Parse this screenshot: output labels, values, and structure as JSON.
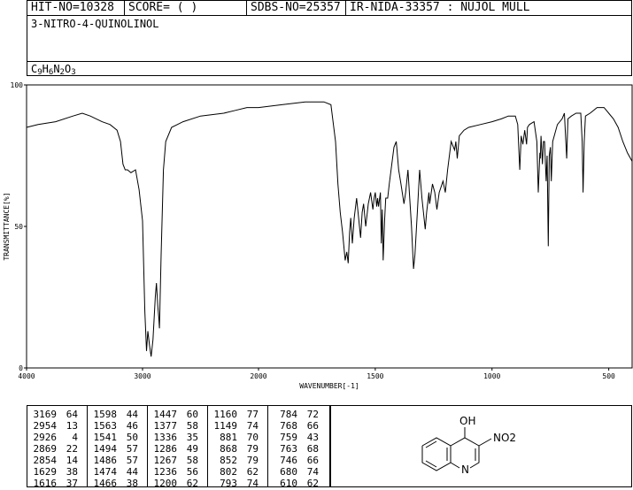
{
  "header": {
    "hit_no": "HIT-NO=10328",
    "score": "SCORE=  (   )",
    "sdbs_no": "SDBS-NO=25357",
    "ir_info": "IR-NIDA-33357 : NUJOL MULL",
    "compound_name": "3-NITRO-4-QUINOLINOL",
    "formula_parts": [
      {
        "t": "C",
        "sub": false
      },
      {
        "t": "9",
        "sub": true
      },
      {
        "t": "H",
        "sub": false
      },
      {
        "t": "6",
        "sub": true
      },
      {
        "t": "N",
        "sub": false
      },
      {
        "t": "2",
        "sub": true
      },
      {
        "t": "O",
        "sub": false
      },
      {
        "t": "3",
        "sub": true
      }
    ]
  },
  "chart_data": {
    "type": "line",
    "xlabel": "WAVENUMBER[-1]",
    "ylabel": "TRANSMITTANCE[%]",
    "xlim": [
      4000,
      400
    ],
    "ylim": [
      0,
      100
    ],
    "x_ticks": [
      4000,
      3000,
      2000,
      1500,
      1000,
      500
    ],
    "y_ticks": [
      0,
      50,
      100
    ],
    "series": [
      {
        "points": [
          [
            4000,
            85
          ],
          [
            3900,
            86
          ],
          [
            3750,
            87
          ],
          [
            3600,
            89
          ],
          [
            3520,
            90
          ],
          [
            3450,
            89
          ],
          [
            3350,
            87
          ],
          [
            3280,
            86
          ],
          [
            3220,
            84
          ],
          [
            3190,
            80
          ],
          [
            3169,
            72
          ],
          [
            3150,
            70
          ],
          [
            3130,
            70
          ],
          [
            3100,
            69
          ],
          [
            3060,
            70
          ],
          [
            3030,
            63
          ],
          [
            3000,
            52
          ],
          [
            2980,
            20
          ],
          [
            2966,
            6
          ],
          [
            2954,
            13
          ],
          [
            2940,
            8
          ],
          [
            2926,
            4
          ],
          [
            2910,
            10
          ],
          [
            2890,
            25
          ],
          [
            2880,
            30
          ],
          [
            2869,
            22
          ],
          [
            2860,
            18
          ],
          [
            2854,
            14
          ],
          [
            2840,
            40
          ],
          [
            2820,
            70
          ],
          [
            2800,
            80
          ],
          [
            2750,
            85
          ],
          [
            2700,
            86
          ],
          [
            2650,
            87
          ],
          [
            2500,
            89
          ],
          [
            2300,
            90
          ],
          [
            2200,
            91
          ],
          [
            2100,
            92
          ],
          [
            2000,
            92
          ],
          [
            1900,
            93
          ],
          [
            1800,
            94
          ],
          [
            1720,
            94
          ],
          [
            1690,
            93
          ],
          [
            1670,
            80
          ],
          [
            1660,
            65
          ],
          [
            1650,
            55
          ],
          [
            1640,
            48
          ],
          [
            1629,
            38
          ],
          [
            1622,
            41
          ],
          [
            1616,
            37
          ],
          [
            1610,
            48
          ],
          [
            1605,
            53
          ],
          [
            1598,
            44
          ],
          [
            1590,
            53
          ],
          [
            1580,
            60
          ],
          [
            1570,
            52
          ],
          [
            1563,
            46
          ],
          [
            1556,
            55
          ],
          [
            1550,
            58
          ],
          [
            1541,
            50
          ],
          [
            1530,
            58
          ],
          [
            1520,
            62
          ],
          [
            1510,
            56
          ],
          [
            1505,
            60
          ],
          [
            1500,
            62
          ],
          [
            1494,
            57
          ],
          [
            1490,
            60
          ],
          [
            1486,
            57
          ],
          [
            1478,
            62
          ],
          [
            1474,
            44
          ],
          [
            1470,
            56
          ],
          [
            1466,
            38
          ],
          [
            1460,
            52
          ],
          [
            1455,
            60
          ],
          [
            1447,
            60
          ],
          [
            1440,
            65
          ],
          [
            1420,
            78
          ],
          [
            1410,
            80
          ],
          [
            1400,
            70
          ],
          [
            1390,
            65
          ],
          [
            1377,
            58
          ],
          [
            1370,
            62
          ],
          [
            1360,
            70
          ],
          [
            1345,
            50
          ],
          [
            1336,
            35
          ],
          [
            1330,
            40
          ],
          [
            1320,
            55
          ],
          [
            1310,
            70
          ],
          [
            1300,
            60
          ],
          [
            1290,
            52
          ],
          [
            1286,
            49
          ],
          [
            1280,
            55
          ],
          [
            1270,
            62
          ],
          [
            1267,
            58
          ],
          [
            1255,
            65
          ],
          [
            1245,
            62
          ],
          [
            1236,
            56
          ],
          [
            1226,
            62
          ],
          [
            1210,
            66
          ],
          [
            1200,
            62
          ],
          [
            1190,
            70
          ],
          [
            1175,
            80
          ],
          [
            1160,
            77
          ],
          [
            1155,
            80
          ],
          [
            1149,
            74
          ],
          [
            1140,
            82
          ],
          [
            1120,
            84
          ],
          [
            1100,
            85
          ],
          [
            1050,
            86
          ],
          [
            1000,
            87
          ],
          [
            960,
            88
          ],
          [
            930,
            89
          ],
          [
            900,
            89
          ],
          [
            890,
            86
          ],
          [
            881,
            70
          ],
          [
            875,
            82
          ],
          [
            868,
            79
          ],
          [
            860,
            84
          ],
          [
            852,
            79
          ],
          [
            848,
            85
          ],
          [
            840,
            86
          ],
          [
            820,
            87
          ],
          [
            808,
            80
          ],
          [
            802,
            62
          ],
          [
            795,
            76
          ],
          [
            793,
            74
          ],
          [
            790,
            82
          ],
          [
            784,
            72
          ],
          [
            780,
            80
          ],
          [
            775,
            80
          ],
          [
            768,
            66
          ],
          [
            764,
            75
          ],
          [
            759,
            43
          ],
          [
            755,
            75
          ],
          [
            750,
            78
          ],
          [
            746,
            66
          ],
          [
            740,
            80
          ],
          [
            720,
            86
          ],
          [
            700,
            88
          ],
          [
            690,
            90
          ],
          [
            680,
            74
          ],
          [
            675,
            88
          ],
          [
            660,
            89
          ],
          [
            640,
            90
          ],
          [
            620,
            90
          ],
          [
            614,
            80
          ],
          [
            610,
            62
          ],
          [
            605,
            80
          ],
          [
            600,
            89
          ],
          [
            580,
            90
          ],
          [
            550,
            92
          ],
          [
            520,
            92
          ],
          [
            500,
            90
          ],
          [
            480,
            88
          ],
          [
            460,
            85
          ],
          [
            440,
            80
          ],
          [
            420,
            76
          ],
          [
            400,
            73
          ]
        ]
      }
    ]
  },
  "peak_table": {
    "columns": [
      [
        [
          "3169",
          "64"
        ],
        [
          "2954",
          "13"
        ],
        [
          "2926",
          "4"
        ],
        [
          "2869",
          "22"
        ],
        [
          "2854",
          "14"
        ],
        [
          "1629",
          "38"
        ],
        [
          "1616",
          "37"
        ]
      ],
      [
        [
          "1598",
          "44"
        ],
        [
          "1563",
          "46"
        ],
        [
          "1541",
          "50"
        ],
        [
          "1494",
          "57"
        ],
        [
          "1486",
          "57"
        ],
        [
          "1474",
          "44"
        ],
        [
          "1466",
          "38"
        ]
      ],
      [
        [
          "1447",
          "60"
        ],
        [
          "1377",
          "58"
        ],
        [
          "1336",
          "35"
        ],
        [
          "1286",
          "49"
        ],
        [
          "1267",
          "58"
        ],
        [
          "1236",
          "56"
        ],
        [
          "1200",
          "62"
        ]
      ],
      [
        [
          "1160",
          "77"
        ],
        [
          "1149",
          "74"
        ],
        [
          "881",
          "70"
        ],
        [
          "868",
          "79"
        ],
        [
          "852",
          "79"
        ],
        [
          "802",
          "62"
        ],
        [
          "793",
          "74"
        ]
      ],
      [
        [
          "784",
          "72"
        ],
        [
          "768",
          "66"
        ],
        [
          "759",
          "43"
        ],
        [
          "763",
          "68"
        ],
        [
          "746",
          "66"
        ],
        [
          "680",
          "74"
        ],
        [
          "610",
          "62"
        ]
      ]
    ]
  },
  "structure": {
    "oh_label": "OH",
    "no2_label": "NO2",
    "n_label": "N"
  }
}
